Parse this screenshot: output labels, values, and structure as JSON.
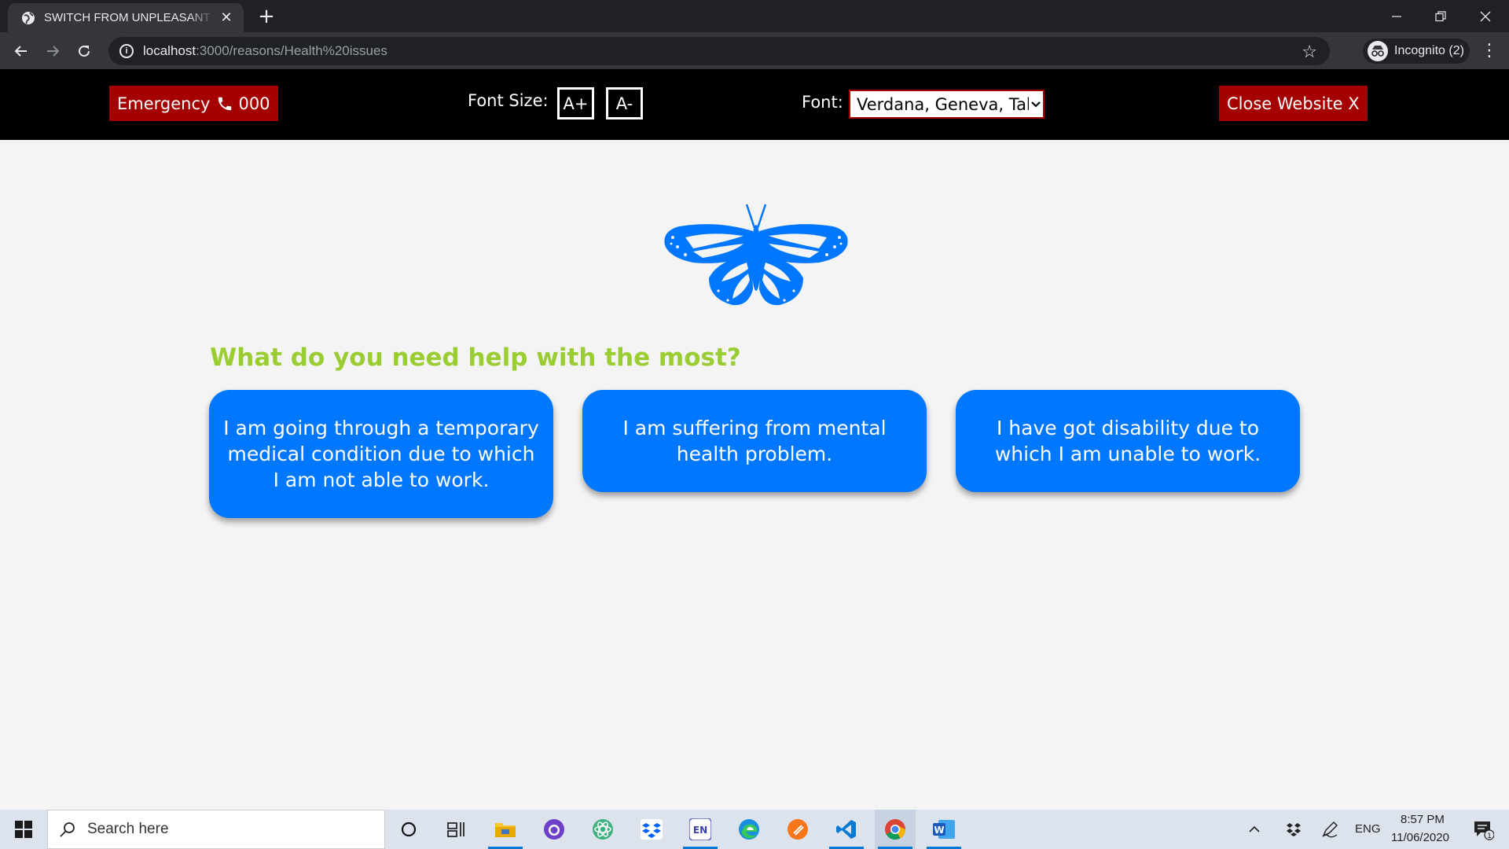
{
  "browser": {
    "tab_title": "SWITCH FROM UNPLEASANT SCENARIOS",
    "tab_close": "✕",
    "new_tab": "+",
    "url_host": "localhost",
    "url_path": ":3000/reasons/Health%20issues",
    "incognito_label": "Incognito (2)"
  },
  "site_header": {
    "emergency_label": "Emergency",
    "emergency_number": "000",
    "font_size_label": "Font Size:",
    "increase_label": "A+",
    "decrease_label": "A-",
    "font_label": "Font:",
    "font_selected": "Verdana, Geneva, Tahoma, sans-serif",
    "close_label": "Close Website X"
  },
  "main": {
    "question": "What do you need help with the most?",
    "options": [
      {
        "label": "I am going through a temporary medical condition due to which I am not able to work."
      },
      {
        "label": "I am suffering from mental health problem."
      },
      {
        "label": "I have got disability due to which I am unable to work."
      }
    ]
  },
  "colors": {
    "accent_blue": "#0077ff",
    "header_red": "#a50000",
    "question_green": "#9acd32"
  },
  "taskbar": {
    "search_placeholder": "Search here",
    "language": "ENG",
    "time": "8:57 PM",
    "date": "11/06/2020",
    "notification_count": "1",
    "apps": [
      "cortana-icon",
      "task-view-icon",
      "file-explorer-icon",
      "github-desktop-icon",
      "atom-icon",
      "dropbox-icon",
      "evernote-icon",
      "edge-icon",
      "brave-icon",
      "vscode-icon",
      "chrome-icon",
      "word-icon"
    ]
  }
}
